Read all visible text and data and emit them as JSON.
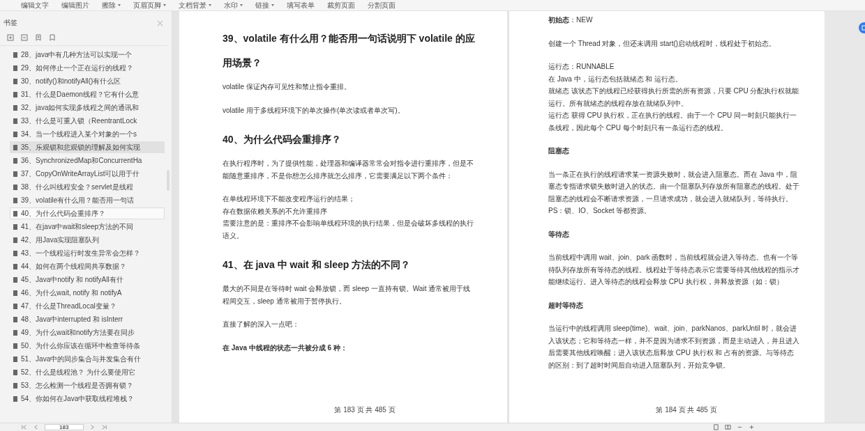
{
  "toolbar": [
    {
      "label": "编辑文字",
      "dropdown": false
    },
    {
      "label": "编辑图片",
      "dropdown": false
    },
    {
      "label": "擦除",
      "dropdown": true
    },
    {
      "label": "页眉页脚",
      "dropdown": true
    },
    {
      "label": "文档背景",
      "dropdown": true
    },
    {
      "label": "水印",
      "dropdown": true
    },
    {
      "label": "链接",
      "dropdown": true
    },
    {
      "label": "填写表单",
      "dropdown": false
    },
    {
      "label": "裁剪页面",
      "dropdown": false
    },
    {
      "label": "分割页面",
      "dropdown": false
    }
  ],
  "sidebar": {
    "title": "书签",
    "items": [
      {
        "label": "28、java中有几种方法可以实现一个",
        "selected": false,
        "outlined": false
      },
      {
        "label": "29、如何停止一个正在运行的线程？",
        "selected": false,
        "outlined": false
      },
      {
        "label": "30、notify()和notifyAll()有什么区",
        "selected": false,
        "outlined": false
      },
      {
        "label": "31、什么是Daemon线程？它有什么意",
        "selected": false,
        "outlined": false
      },
      {
        "label": "32、java如何实现多线程之间的通讯和",
        "selected": false,
        "outlined": false
      },
      {
        "label": "33、什么是可重入锁（ReentrantLock",
        "selected": false,
        "outlined": false
      },
      {
        "label": "34、当一个线程进入某个对象的一个s",
        "selected": false,
        "outlined": false
      },
      {
        "label": "35、乐观锁和悲观锁的理解及如何实现",
        "selected": true,
        "outlined": false
      },
      {
        "label": "36、SynchronizedMap和ConcurrentHa",
        "selected": false,
        "outlined": false
      },
      {
        "label": "37、CopyOnWriteArrayList可以用于什",
        "selected": false,
        "outlined": false
      },
      {
        "label": "38、什么叫线程安全？servlet是线程",
        "selected": false,
        "outlined": false
      },
      {
        "label": "39、volatile有什么用？能否用一句话",
        "selected": false,
        "outlined": false
      },
      {
        "label": "40、为什么代码会重排序？",
        "selected": false,
        "outlined": true
      },
      {
        "label": "41、在java中wait和sleep方法的不同",
        "selected": false,
        "outlined": false
      },
      {
        "label": "42、用Java实现阻塞队列",
        "selected": false,
        "outlined": false
      },
      {
        "label": "43、一个线程运行时发生异常会怎样？",
        "selected": false,
        "outlined": false
      },
      {
        "label": "44、如何在两个线程间共享数据？",
        "selected": false,
        "outlined": false
      },
      {
        "label": "45、Java中notify 和 notifyAll有什",
        "selected": false,
        "outlined": false
      },
      {
        "label": "46、为什么wait, notify 和 notifyA",
        "selected": false,
        "outlined": false
      },
      {
        "label": "47、什么是ThreadLocal变量？",
        "selected": false,
        "outlined": false
      },
      {
        "label": "48、Java中interrupted 和 isInterr",
        "selected": false,
        "outlined": false
      },
      {
        "label": "49、为什么wait和notify方法要在同步",
        "selected": false,
        "outlined": false
      },
      {
        "label": "50、为什么你应该在循环中检查等待条",
        "selected": false,
        "outlined": false
      },
      {
        "label": "51、Java中的同步集合与并发集合有什",
        "selected": false,
        "outlined": false
      },
      {
        "label": "52、什么是线程池？ 为什么要使用它",
        "selected": false,
        "outlined": false
      },
      {
        "label": "53、怎么检测一个线程是否拥有锁？",
        "selected": false,
        "outlined": false
      },
      {
        "label": "54、你如何在Java中获取线程堆栈？",
        "selected": false,
        "outlined": false
      }
    ]
  },
  "pages": [
    {
      "blocks": [
        {
          "kind": "heading",
          "text": "39、volatile 有什么用？能否用一句话说明下 volatile 的应用场景？"
        },
        {
          "kind": "paragraph",
          "text": "volatile 保证内存可见性和禁止指令重排。"
        },
        {
          "kind": "paragraph",
          "text": "volatile 用于多线程环境下的单次操作(单次读或者单次写)。"
        },
        {
          "kind": "heading",
          "text": "40、为什么代码会重排序？"
        },
        {
          "kind": "paragraph",
          "text": "在执行程序时，为了提供性能，处理器和编译器常常会对指令进行重排序，但是不能随意重排序，不是你想怎么排序就怎么排序，它需要满足以下两个条件："
        },
        {
          "kind": "line",
          "text": "在单线程环境下不能改变程序运行的结果；"
        },
        {
          "kind": "line",
          "text": "存在数据依赖关系的不允许重排序"
        },
        {
          "kind": "paragraph",
          "text": "需要注意的是：重排序不会影响单线程环境的执行结果，但是会破坏多线程的执行语义。"
        },
        {
          "kind": "heading",
          "text": "41、在 java 中 wait 和 sleep 方法的不同？"
        },
        {
          "kind": "paragraph",
          "text": "最大的不同是在等待时 wait 会释放锁，而 sleep 一直持有锁。Wait 通常被用于线程间交互，sleep 通常被用于暂停执行。"
        },
        {
          "kind": "paragraph",
          "text": "直接了解的深入一点吧："
        },
        {
          "kind": "bold",
          "text": "在 Java 中线程的状态一共被分成 6 种："
        }
      ],
      "footer": "第 183 页 共 485 页"
    },
    {
      "blocks": [
        {
          "kind": "paragraph",
          "text": "**初始态**：NEW"
        },
        {
          "kind": "paragraph",
          "text": "创建一个 Thread 对象，但还未调用 start()启动线程时，线程处于初始态。"
        },
        {
          "kind": "line",
          "text": "运行态：RUNNABLE"
        },
        {
          "kind": "line",
          "text": "在 Java 中，运行态包括就绪态 和 运行态。"
        },
        {
          "kind": "line",
          "text": "就绪态 该状态下的线程已经获得执行所需的所有资源，只要 CPU 分配执行权就能运行。所有就绪态的线程存放在就绪队列中。"
        },
        {
          "kind": "paragraph",
          "text": "运行态 获得 CPU 执行权，正在执行的线程。由于一个 CPU 同一时刻只能执行一条线程，因此每个 CPU 每个时刻只有一条运行态的线程。"
        },
        {
          "kind": "bold",
          "text": "阻塞态"
        },
        {
          "kind": "line",
          "text": "当一条正在执行的线程请求某一资源失败时，就会进入阻塞态。而在 Java 中，阻塞态专指请求锁失败时进入的状态。由一个阻塞队列存放所有阻塞态的线程。处于阻塞态的线程会不断请求资源，一旦请求成功，就会进入就绪队列，等待执行。"
        },
        {
          "kind": "paragraph",
          "text": "PS：锁、IO、Socket 等都资源。"
        },
        {
          "kind": "bold",
          "text": "等待态"
        },
        {
          "kind": "paragraph",
          "text": "当前线程中调用 wait、join、park 函数时，当前线程就会进入等待态。也有一个等待队列存放所有等待态的线程。线程处于等待态表示它需要等待其他线程的指示才能继续运行。进入等待态的线程会释放 CPU 执行权，并释放资源（如：锁）"
        },
        {
          "kind": "bold",
          "text": "超时等待态"
        },
        {
          "kind": "paragraph",
          "text": "当运行中的线程调用 sleep(time)、wait、join、parkNanos、parkUntil 时，就会进入该状态；它和等待态一样，并不是因为请求不到资源，而是主动进入，并且进入后需要其他线程唤醒；进入该状态后释放 CPU 执行权 和 占有的资源。与等待态的区别：到了超时时间后自动进入阻塞队列，开始竞争锁。"
        }
      ],
      "footer": "第 184 页 共 485 页"
    }
  ],
  "status_bar": {
    "page_field": "183"
  }
}
